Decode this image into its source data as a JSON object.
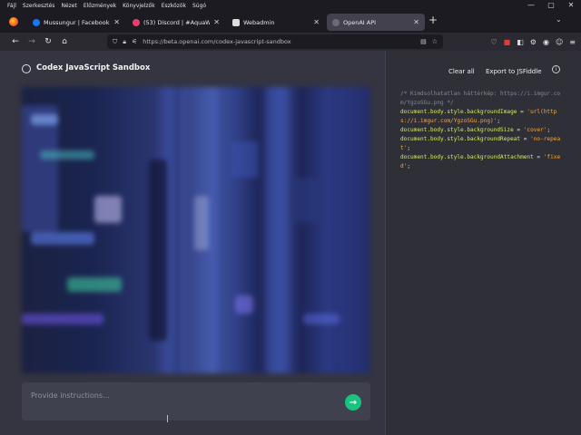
{
  "browser": {
    "menu": [
      "Fájl",
      "Szerkesztés",
      "Nézet",
      "Előzmények",
      "Könyvjelzők",
      "Eszközök",
      "Súgó"
    ],
    "tabs": [
      {
        "label": "Mussungur | Facebook",
        "color": "#1877f2",
        "active": false
      },
      {
        "label": "(53) Discord | #AquaWolf04",
        "color": "#5865f2",
        "active": false
      },
      {
        "label": "Webadmin",
        "color": "#dddddd",
        "active": false
      },
      {
        "label": "OpenAI API",
        "color": "#444654",
        "active": true
      }
    ],
    "url": "https://beta.openai.com/codex-javascript-sandbox"
  },
  "page": {
    "title": "Codex JavaScript Sandbox",
    "clear_label": "Clear all",
    "export_label": "Export to JSFiddle",
    "input_placeholder": "Provide instructions..."
  },
  "code": {
    "comment": "/* Kimdsolhatatlan háttérkép: https://i.imgur.com/YgzoSGu.png */",
    "lines": [
      {
        "obj": "document.body.style.backgroundImage",
        "val": "'url(https://i.imgur.com/YgzoSGu.png)'"
      },
      {
        "obj": "document.body.style.backgroundSize",
        "val": "'cover'"
      },
      {
        "obj": "document.body.style.backgroundRepeat",
        "val": "'no-repeat'"
      },
      {
        "obj": "document.body.style.backgroundAttachment",
        "val": "'fixed'"
      }
    ]
  },
  "colors": {
    "accent": "#19c37d",
    "panel": "#343541",
    "input": "#40414f"
  }
}
